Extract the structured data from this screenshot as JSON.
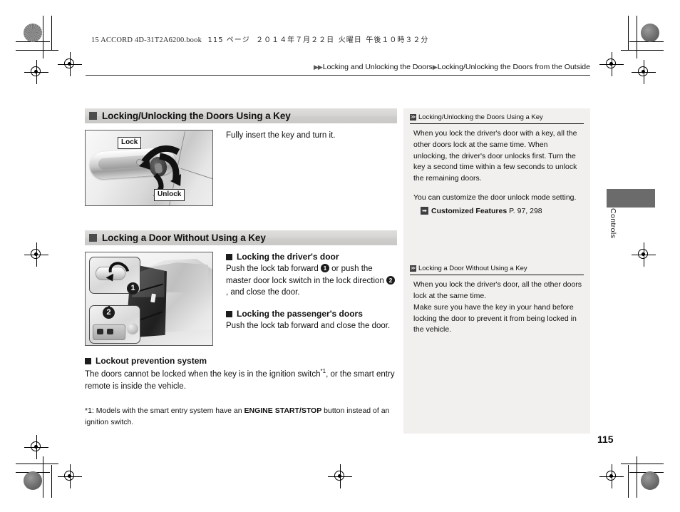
{
  "print_slug": {
    "text": "15 ACCORD 4D-31T2A6200.book",
    "page_label": "115 ページ",
    "date": "２０１４年７月２２日",
    "weekday": "火曜日",
    "time": "午後１０時３２分"
  },
  "breadcrumb": {
    "level1": "Locking and Unlocking the Doors",
    "level2": "Locking/Unlocking the Doors from the Outside",
    "marker": "▶"
  },
  "sections": [
    {
      "heading": "Locking/Unlocking the Doors Using a Key",
      "figure": {
        "name": "door-handle-key-illustration",
        "labels": {
          "lock": "Lock",
          "unlock": "Unlock"
        }
      },
      "caption": "Fully insert the key and turn it."
    },
    {
      "heading": "Locking a Door Without Using a Key",
      "figure": {
        "name": "door-interior-lock-illustration",
        "callouts": [
          "1",
          "2"
        ]
      },
      "blocks": [
        {
          "subheading": "Locking the driver's door",
          "text_a": "Push the lock tab forward ",
          "marker_1": "1",
          "text_b": " or push the master door lock switch in the lock direction ",
          "marker_2": "2",
          "text_c": ", and close the door."
        },
        {
          "subheading": "Locking the passenger's doors",
          "text": "Push the lock tab forward and close the door."
        }
      ]
    }
  ],
  "lockout": {
    "subheading": "Lockout prevention system",
    "text_a": "The doors cannot be locked when the key is in the ignition switch",
    "footnote_mark": "*1",
    "text_b": ", or the smart entry remote is inside the vehicle."
  },
  "footnote": {
    "mark": "*1:",
    "text_a": " Models with the smart entry system have an ",
    "bold": "ENGINE START/STOP",
    "text_b": " button instead of an ignition switch."
  },
  "sidebar": [
    {
      "heading": "Locking/Unlocking the Doors Using a Key",
      "marker": "≫",
      "paragraphs": [
        "When you lock the driver's door with a key, all the other doors lock at the same time. When unlocking, the driver's door unlocks first. Turn the key a second time within a few seconds to unlock the remaining doors.",
        "You can customize the door unlock mode setting."
      ],
      "reference": {
        "icon": "➡",
        "title": "Customized Features",
        "pages": "P. 97, 298"
      }
    },
    {
      "heading": "Locking a Door Without Using a Key",
      "marker": "≫",
      "paragraphs": [
        "When you lock the driver's door, all the other doors lock at the same time.",
        "Make sure you have the key in your hand before locking the door to prevent it from being locked in the vehicle."
      ]
    }
  ],
  "edge_tab": {
    "label": "Controls",
    "color": "#6b6b6b"
  },
  "page_number": "115",
  "colors": {
    "heading_bar": "#d4d3d1",
    "sidebar_bg": "#f1f0ee",
    "ink": "#111111"
  }
}
